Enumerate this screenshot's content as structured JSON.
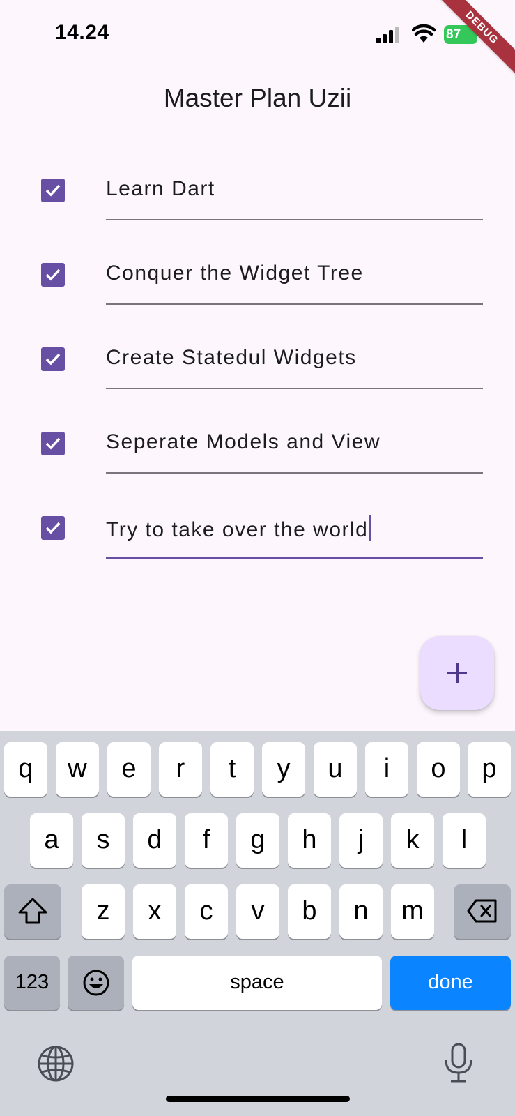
{
  "status_bar": {
    "time": "14.24",
    "battery": "87"
  },
  "debug_banner": "DEBUG",
  "app": {
    "title": "Master Plan Uzii"
  },
  "tasks": [
    {
      "text": "Learn Dart",
      "done": true
    },
    {
      "text": "Conquer the Widget Tree",
      "done": true
    },
    {
      "text": "Create Statedul Widgets",
      "done": true
    },
    {
      "text": "Seperate Models and View",
      "done": true
    },
    {
      "text": "Try to take over the world",
      "done": true
    }
  ],
  "fab": {
    "icon": "plus-icon"
  },
  "keyboard": {
    "row1": [
      "q",
      "w",
      "e",
      "r",
      "t",
      "y",
      "u",
      "i",
      "o",
      "p"
    ],
    "row2": [
      "a",
      "s",
      "d",
      "f",
      "g",
      "h",
      "j",
      "k",
      "l"
    ],
    "row3": [
      "z",
      "x",
      "c",
      "v",
      "b",
      "n",
      "m"
    ],
    "numbers_label": "123",
    "space_label": "space",
    "done_label": "done"
  },
  "colors": {
    "accent": "#6750a4",
    "fab": "#eaddff",
    "done_key": "#0a84ff"
  }
}
